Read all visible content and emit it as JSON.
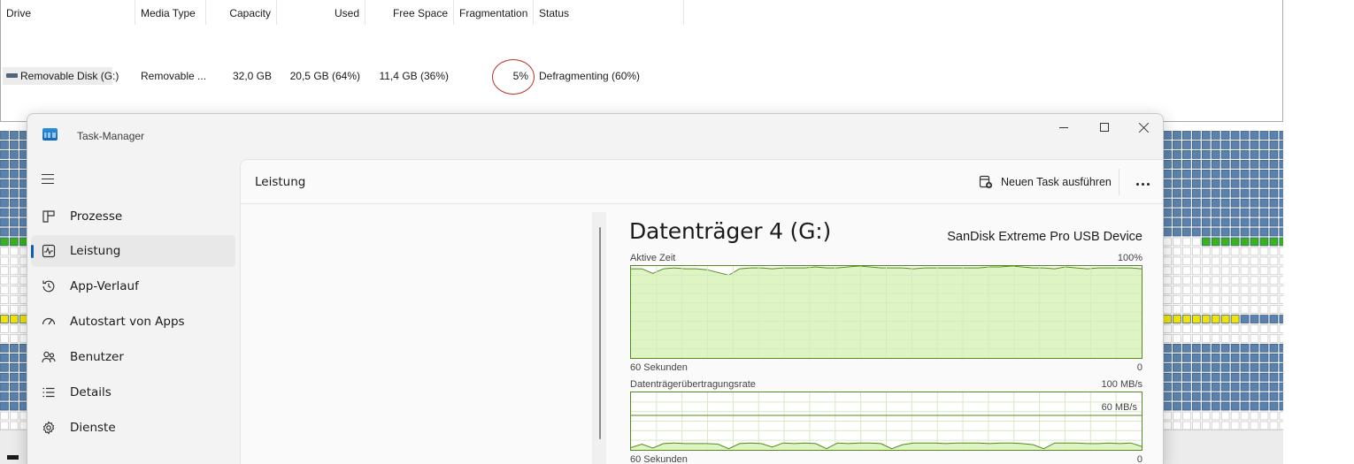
{
  "defrag": {
    "columns": [
      "Drive",
      "Media Type",
      "Capacity",
      "Used",
      "Free Space",
      "Fragmentation",
      "Status"
    ],
    "row": {
      "drive": "Removable Disk (G:)",
      "media_type": "Removable ...",
      "capacity": "32,0 GB",
      "used": "20,5 GB (64%)",
      "free_space": "11,4 GB (36%)",
      "fragmentation": "5%",
      "status": "Defragmenting (60%)"
    },
    "block_colors": {
      "used": "#5b82ad",
      "free": "#ffffff",
      "processed": "#36b418",
      "in_progress": "#f2e400"
    }
  },
  "taskmanager": {
    "title": "Task-Manager",
    "nav": [
      {
        "label": "Prozesse",
        "icon": "processes-grid-icon"
      },
      {
        "label": "Leistung",
        "icon": "performance-chart-icon"
      },
      {
        "label": "App-Verlauf",
        "icon": "history-clock-icon"
      },
      {
        "label": "Autostart von Apps",
        "icon": "startup-gauge-icon"
      },
      {
        "label": "Benutzer",
        "icon": "users-icon"
      },
      {
        "label": "Details",
        "icon": "details-list-icon"
      },
      {
        "label": "Dienste",
        "icon": "services-gear-icon"
      }
    ],
    "active_nav": "Leistung",
    "page_title": "Leistung",
    "run_task_label": "Neuen Task ausführen",
    "disk": {
      "title": "Datenträger 4 (G:)",
      "device": "SanDisk Extreme Pro USB Device",
      "active_time": {
        "label": "Aktive Zeit",
        "max_label": "100%",
        "time_label": "60 Sekunden",
        "min_label": "0",
        "values_percent": [
          97,
          97,
          92,
          97,
          98,
          97,
          97,
          96,
          93,
          90,
          97,
          98,
          98,
          97,
          98,
          98,
          98,
          99,
          98,
          98,
          99,
          100,
          99,
          98,
          98,
          98,
          97,
          98,
          98,
          98,
          98,
          98,
          98,
          99,
          99,
          100,
          99,
          98,
          98,
          97,
          99,
          98,
          97,
          98,
          98,
          98,
          98,
          97
        ]
      },
      "transfer_rate": {
        "label": "Datenträgerübertragungsrate",
        "max_label": "100 MB/s",
        "ref_label": "60 MB/s",
        "time_label": "60 Sekunden",
        "min_label": "0",
        "values_mbs": [
          4,
          10,
          3,
          11,
          12,
          11,
          11,
          11,
          10,
          2,
          11,
          12,
          11,
          5,
          12,
          11,
          12,
          11,
          2,
          12,
          11,
          12,
          12,
          11,
          2,
          9,
          12,
          12,
          12,
          11,
          12,
          12,
          12,
          11,
          12,
          12,
          11,
          9,
          2,
          12,
          12,
          12,
          11,
          11,
          12,
          11,
          12,
          6
        ]
      },
      "graph_color": "#548a1e",
      "graph_fill": "#d9f2b8"
    }
  }
}
